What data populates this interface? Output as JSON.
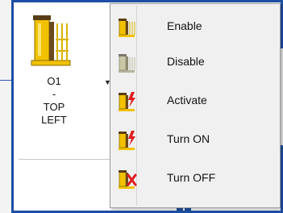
{
  "ribbon": {
    "button": {
      "caption_line1": "O1",
      "caption_line2": "-",
      "caption_line3": "TOP",
      "caption_line4": "LEFT",
      "icon": "output-device-icon",
      "dropdown_icon": "dropdown-arrow-icon"
    }
  },
  "menu": {
    "items": [
      {
        "label": "Enable",
        "icon": "enable-device-icon"
      },
      {
        "label": "Disable",
        "icon": "disable-device-icon"
      },
      {
        "label": "Activate",
        "icon": "activate-device-icon"
      },
      {
        "label": "Turn ON",
        "icon": "turn-on-device-icon"
      },
      {
        "label": "Turn OFF",
        "icon": "turn-off-device-icon"
      }
    ]
  },
  "colors": {
    "frame_blue": "#1c4fa3",
    "icon_yellow": "#f2c200",
    "icon_brown": "#6b4a1e",
    "bolt_red": "#e01b1b"
  }
}
